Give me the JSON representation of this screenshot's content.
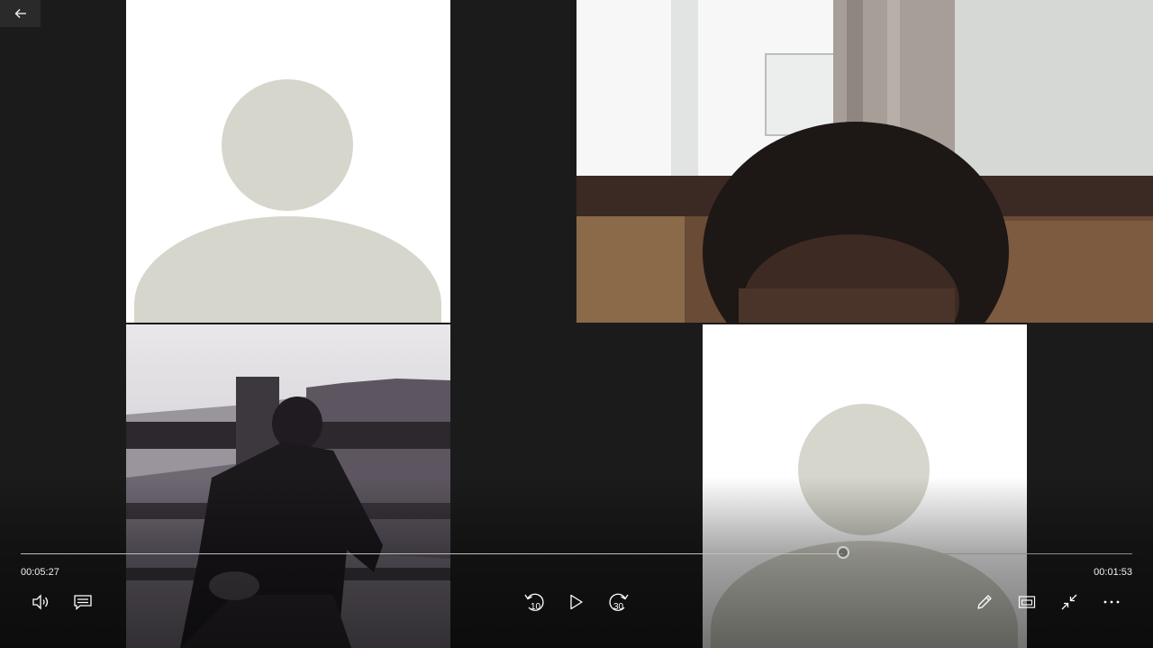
{
  "player": {
    "elapsed_time": "00:05:27",
    "remaining_time": "00:01:53",
    "progress": 0.74,
    "skip_back_seconds": "10",
    "skip_forward_seconds": "30"
  },
  "colors": {
    "background": "#1b1b1b",
    "avatar_placeholder": "#d6d6cc",
    "tile_white": "#ffffff"
  },
  "icons": {
    "back": "arrow-left-icon",
    "volume": "volume-icon",
    "captions": "captions-icon",
    "rewind": "rewind-10-icon",
    "play": "play-icon",
    "forward": "forward-30-icon",
    "edit": "pencil-icon",
    "mini_view": "mini-view-icon",
    "exit_fullscreen": "exit-fullscreen-icon",
    "more": "more-icon"
  }
}
